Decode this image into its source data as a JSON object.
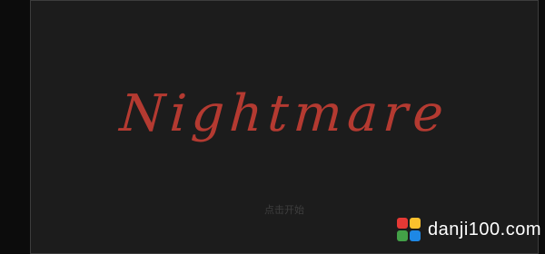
{
  "game": {
    "title": "Nightmare",
    "start_hint": "点击开始"
  },
  "watermark": {
    "text": "danji100.com",
    "logo_colors": [
      "#e53935",
      "#fbc02d",
      "#43a047",
      "#1e88e5"
    ]
  },
  "colors": {
    "title": "#b43a31",
    "background": "#1c1c1c"
  }
}
